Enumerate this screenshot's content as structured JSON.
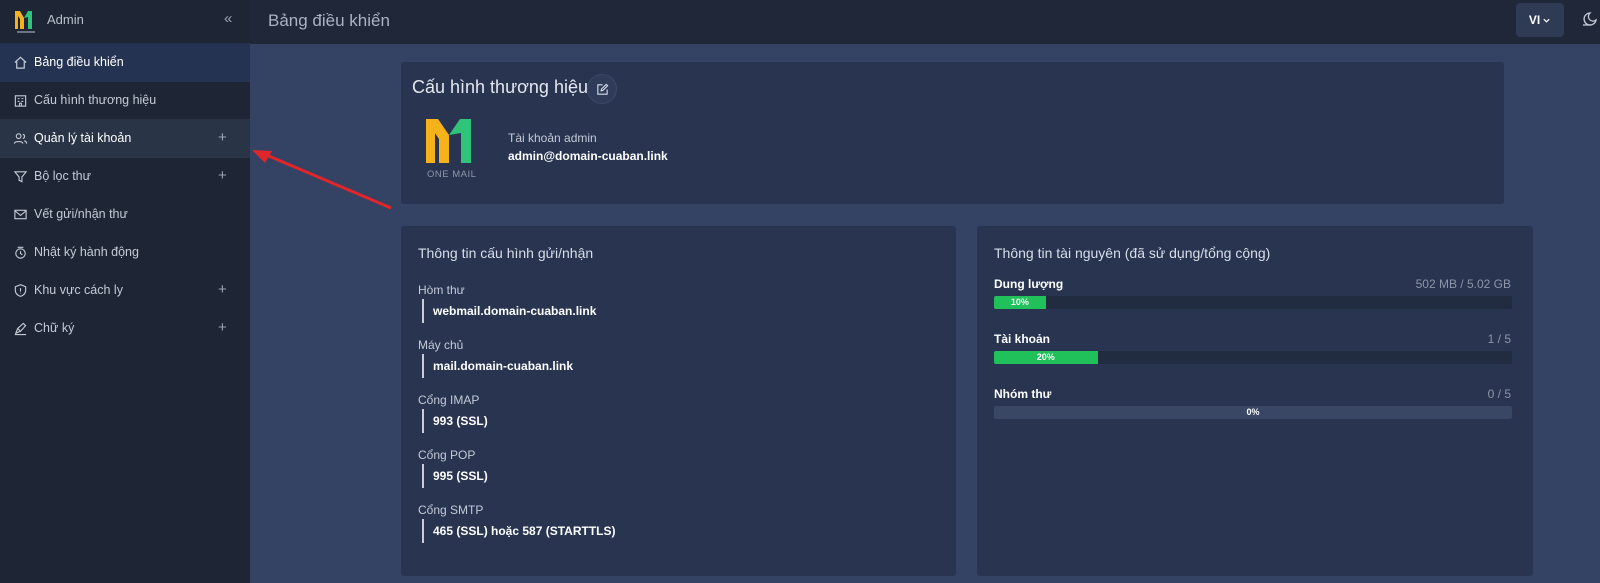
{
  "brand": {
    "name": "Admin"
  },
  "sidebar": {
    "items": [
      {
        "label": "Bảng điều khiển",
        "has_plus": false
      },
      {
        "label": "Cấu hình thương hiệu",
        "has_plus": false
      },
      {
        "label": "Quản lý tài khoản",
        "has_plus": true
      },
      {
        "label": "Bộ lọc thư",
        "has_plus": true
      },
      {
        "label": "Vết gửi/nhận thư",
        "has_plus": false
      },
      {
        "label": "Nhật ký hành động",
        "has_plus": false
      },
      {
        "label": "Khu vực cách ly",
        "has_plus": true
      },
      {
        "label": "Chữ ký",
        "has_plus": true
      }
    ]
  },
  "header": {
    "title": "Bảng điều khiển",
    "lang": "VI"
  },
  "brand_card": {
    "title": "Cấu hình thương hiệu",
    "logo_caption": "ONE MAIL",
    "account_label": "Tài khoản admin",
    "account_email": "admin@domain-cuaban.link"
  },
  "config_card": {
    "title": "Thông tin cấu hình gửi/nhận",
    "fields": [
      {
        "label": "Hòm thư",
        "value": "webmail.domain-cuaban.link"
      },
      {
        "label": "Máy chủ",
        "value": "mail.domain-cuaban.link"
      },
      {
        "label": "Cổng IMAP",
        "value": "993 (SSL)"
      },
      {
        "label": "Cổng POP",
        "value": "995 (SSL)"
      },
      {
        "label": "Cổng SMTP",
        "value": "465 (SSL) hoặc 587 (STARTTLS)"
      }
    ]
  },
  "resource_card": {
    "title": "Thông tin tài nguyên (đã sử dụng/tổng cộng)",
    "items": [
      {
        "label": "Dung lượng",
        "value": "502 MB / 5.02 GB",
        "percent": 10,
        "percent_text": "10%"
      },
      {
        "label": "Tài khoản",
        "value": "1 / 5",
        "percent": 20,
        "percent_text": "20%"
      },
      {
        "label": "Nhóm thư",
        "value": "0 / 5",
        "percent": 0,
        "percent_text": "0%"
      }
    ]
  },
  "colors": {
    "accent_green": "#20c05a",
    "logo_yellow": "#f6b21a",
    "logo_green": "#2fc47a",
    "annotation_red": "#e0262a"
  }
}
